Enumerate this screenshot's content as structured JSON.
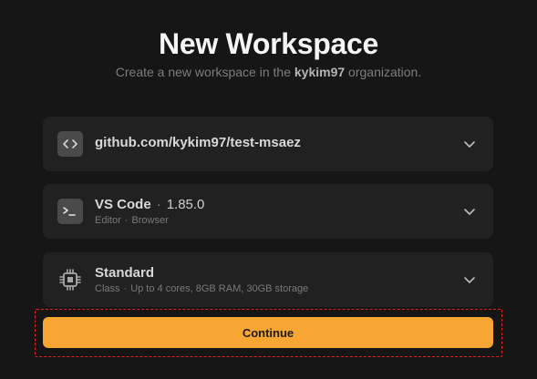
{
  "header": {
    "title": "New Workspace",
    "subtitle_prefix": "Create a new workspace in the",
    "organization": "kykim97",
    "subtitle_suffix": "organization."
  },
  "repository": {
    "icon": "code-brackets-icon",
    "value": "github.com/kykim97/test-msaez"
  },
  "editor": {
    "icon": "terminal-icon",
    "name": "VS Code",
    "version": "1.85.0",
    "type_label": "Editor",
    "mode": "Browser"
  },
  "workspace_class": {
    "icon": "cpu-chip-icon",
    "name": "Standard",
    "type_label": "Class",
    "description": "Up to 4 cores, 8GB RAM, 30GB storage"
  },
  "actions": {
    "continue_label": "Continue"
  },
  "colors": {
    "background": "#161616",
    "card": "#212121",
    "accent": "#f7a533",
    "highlight": "#e0201d"
  }
}
